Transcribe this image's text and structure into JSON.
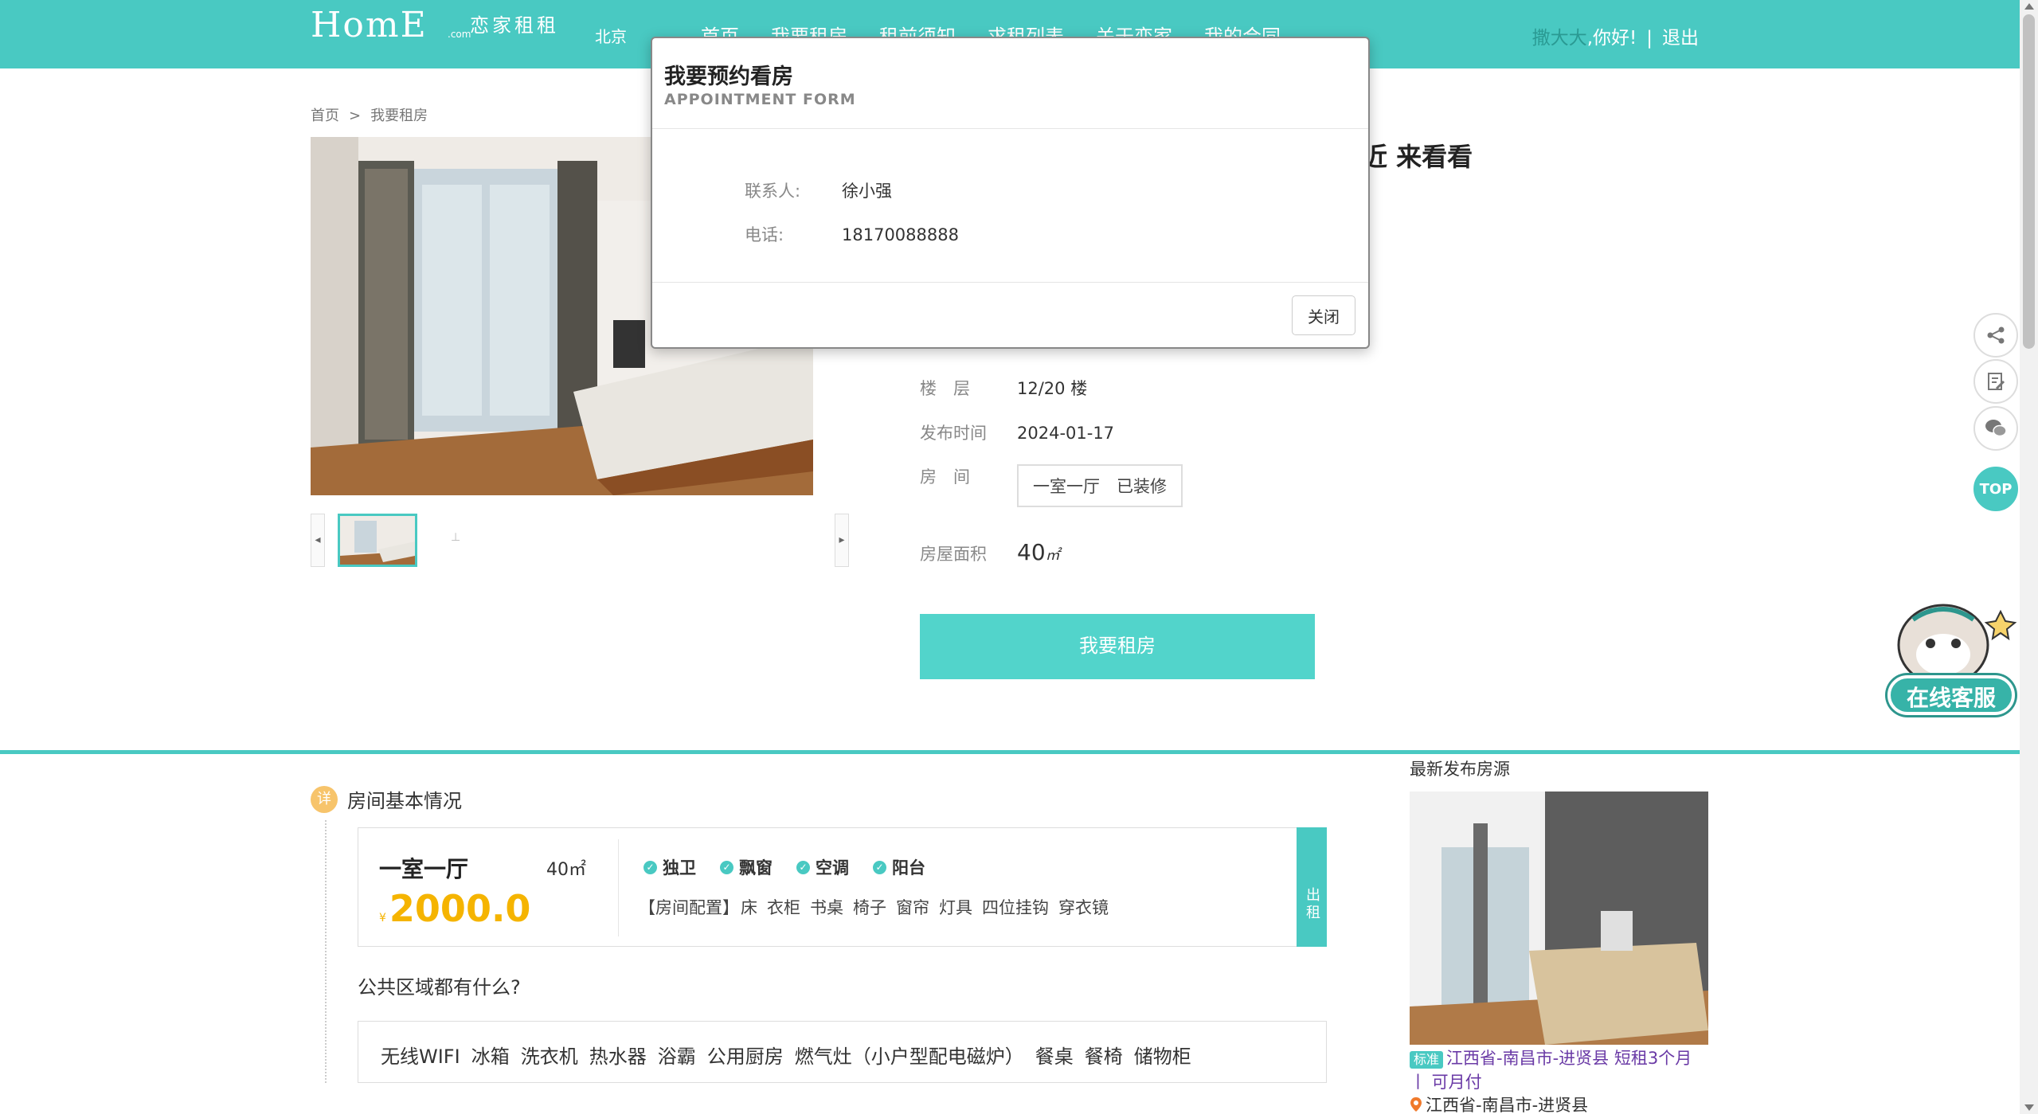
{
  "header": {
    "logo_text": "HomE",
    "logo_com": ".com",
    "logo_cn": "恋家租租",
    "city": "北京",
    "nav": [
      "首页",
      "我要租房",
      "租前须知",
      "求租列表",
      "关于恋家",
      "我的合同"
    ],
    "user_name": "撒大大",
    "greeting": ",你好!",
    "separator": "|",
    "logout": "退出"
  },
  "breadcrumb": {
    "home": "首页",
    "arrow": ">",
    "current": "我要租房"
  },
  "listing": {
    "title_fragment": "近 来看看",
    "floor_label": "楼　层",
    "floor_value": "12/20 楼",
    "publish_label": "发布时间",
    "publish_value": "2024-01-17",
    "room_label": "房　间",
    "room_value": "一室一厅　已装修",
    "area_label": "房屋面积",
    "area_value": "40",
    "area_unit": "㎡",
    "rent_button": "我要租房"
  },
  "tools": {
    "top_label": "TOP",
    "cs_label": "在线客服"
  },
  "room_basic": {
    "section_icon": "详",
    "section_title": "房间基本情况",
    "room_type": "一室一厅",
    "area": "40㎡",
    "currency": "¥",
    "price": "2000.0",
    "features": [
      "独卫",
      "飘窗",
      "空调",
      "阳台"
    ],
    "config_label": "【房间配置】",
    "config_items": [
      "床",
      "衣柜",
      "书桌",
      "椅子",
      "窗帘",
      "灯具",
      "四位挂钩",
      "穿衣镜"
    ],
    "tab_label": "出租",
    "public_question": "公共区域都有什么?",
    "public_items": [
      "无线WIFI",
      "冰箱",
      "洗衣机",
      "热水器",
      "浴霸",
      "公用厨房",
      "燃气灶（小户型配电磁炉）",
      "餐桌",
      "餐椅",
      "储物柜"
    ]
  },
  "newest": {
    "title": "最新发布房源",
    "badge": "标准",
    "line1": "江西省-南昌市-进贤县 短租3个月",
    "line2": "丨 可月付",
    "location": "江西省-南昌市-进贤县"
  },
  "modal": {
    "title": "我要预约看房",
    "subtitle": "APPOINTMENT FORM",
    "contact_label": "联系人:",
    "contact_value": "徐小强",
    "phone_label": "电话:",
    "phone_value": "18170088888",
    "close_button": "关闭"
  },
  "colors": {
    "brand": "#49c9c2",
    "button": "#52d4cb",
    "price": "#f5b400"
  }
}
